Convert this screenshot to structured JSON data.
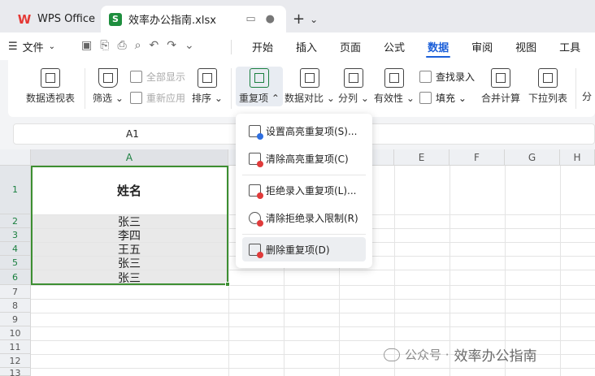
{
  "titlebar": {
    "app_tab": "WPS Office",
    "file_tab": "效率办公指南.xlsx",
    "new_tab_symbol": "+",
    "new_tab_arrow": "⌄"
  },
  "menubar": {
    "file_menu": "文件",
    "tabs": [
      "开始",
      "插入",
      "页面",
      "公式",
      "数据",
      "审阅",
      "视图",
      "工具"
    ],
    "active_tab": "数据"
  },
  "ribbon": {
    "pivot": "数据透视表",
    "filter": "筛选",
    "show_all": "全部显示",
    "reapply": "重新应用",
    "sort": "排序",
    "duplicates": "重复项",
    "compare": "数据对比",
    "split": "分列",
    "validity": "有效性",
    "lookup": "查找录入",
    "fill": "填充",
    "merge_calc": "合并计算",
    "dropdown_list": "下拉列表",
    "cut_off": "分"
  },
  "formula_bar": {
    "name_box": "A1"
  },
  "grid": {
    "columns": [
      "A",
      "E",
      "F",
      "G",
      "H"
    ],
    "rows": [
      "1",
      "2",
      "3",
      "4",
      "5",
      "6",
      "7",
      "8",
      "9",
      "10",
      "11",
      "12",
      "13"
    ],
    "cells": [
      "姓名",
      "张三",
      "李四",
      "王五",
      "张三",
      "张三"
    ]
  },
  "dropdown": {
    "items": [
      "设置高亮重复项(S)...",
      "清除高亮重复项(C)",
      "拒绝录入重复项(L)...",
      "清除拒绝录入限制(R)",
      "删除重复项(D)"
    ]
  },
  "watermark": {
    "text1": "公众号 ·",
    "text2": "效率办公指南"
  }
}
